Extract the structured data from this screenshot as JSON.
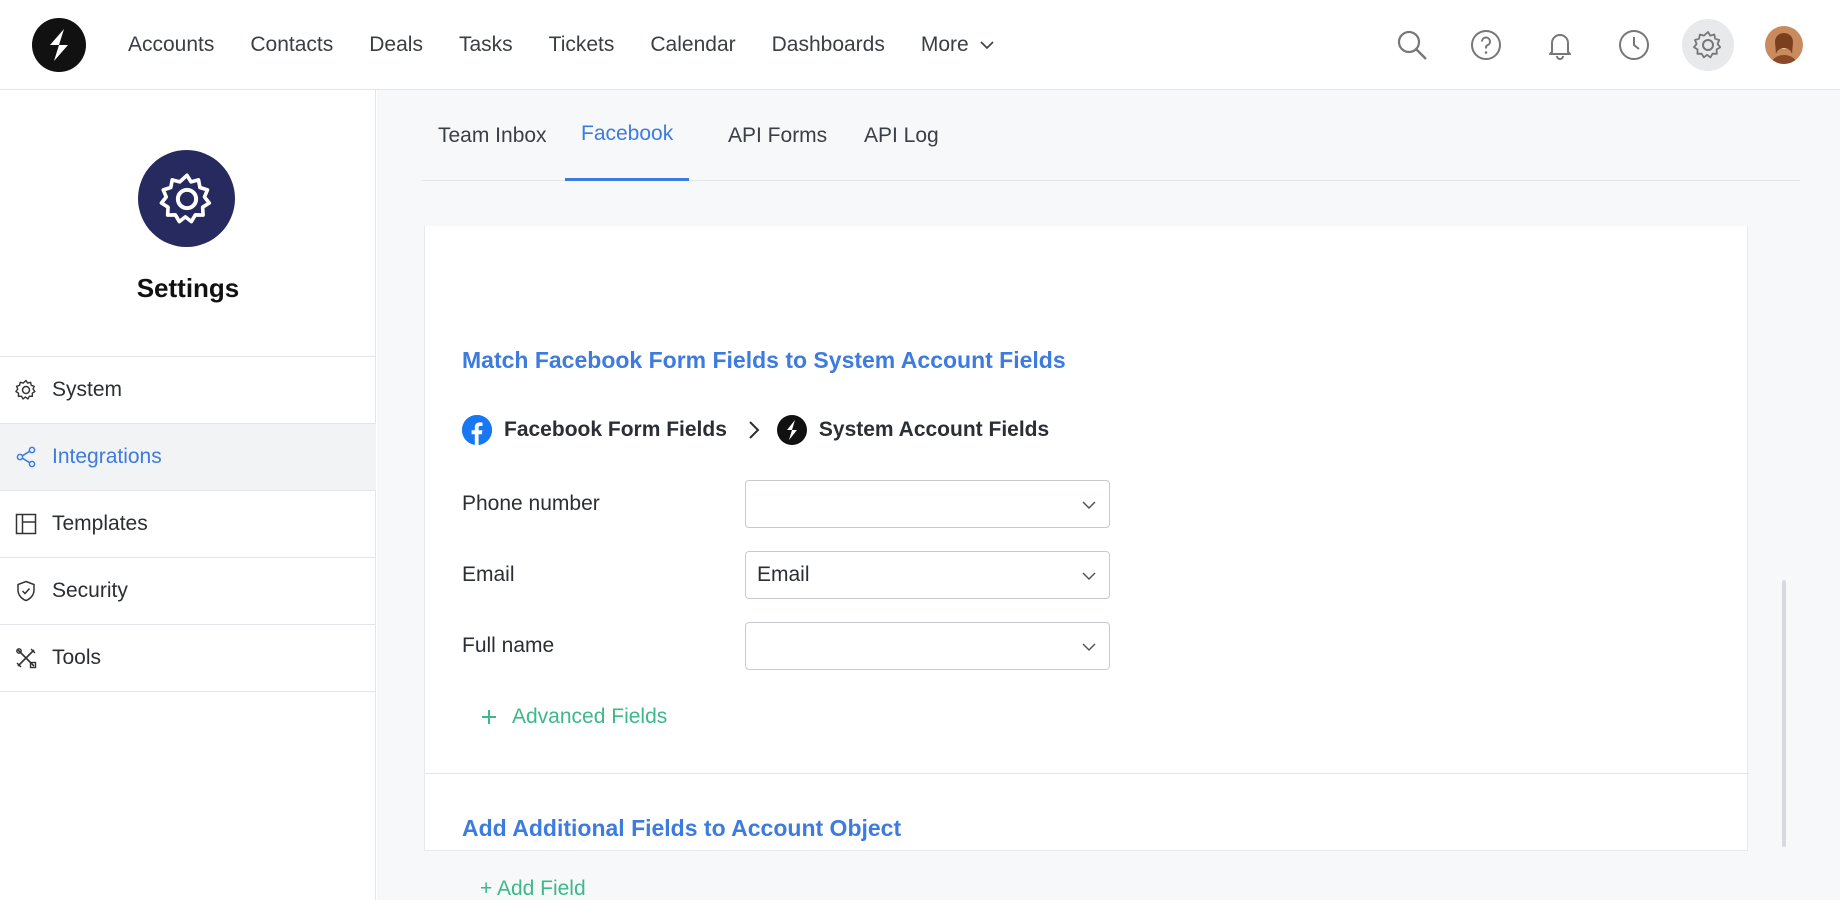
{
  "nav": {
    "items": [
      "Accounts",
      "Contacts",
      "Deals",
      "Tasks",
      "Tickets",
      "Calendar",
      "Dashboards",
      "More"
    ]
  },
  "top_icons": [
    "search-icon",
    "help-icon",
    "bell-icon",
    "clock-icon",
    "gear-icon",
    "avatar"
  ],
  "sidebar": {
    "title": "Settings",
    "items": [
      {
        "label": "System",
        "icon": "gear-icon"
      },
      {
        "label": "Integrations",
        "icon": "share-icon"
      },
      {
        "label": "Templates",
        "icon": "template-icon"
      },
      {
        "label": "Security",
        "icon": "shield-icon"
      },
      {
        "label": "Tools",
        "icon": "tools-icon"
      }
    ]
  },
  "tabs": [
    "Team Inbox",
    "Facebook",
    "API Forms",
    "API Log"
  ],
  "card": {
    "match_title": "Match Facebook Form Fields to System Account Fields",
    "source_label": "Facebook Form Fields",
    "target_label": "System Account Fields",
    "fields": [
      {
        "label": "Phone number",
        "value": ""
      },
      {
        "label": "Email",
        "value": "Email"
      },
      {
        "label": "Full name",
        "value": ""
      }
    ],
    "advanced_label": "Advanced Fields",
    "additional_title": "Add Additional Fields to Account Object",
    "add_field_label": "+ Add Field"
  },
  "colors": {
    "accent": "#3d7be0",
    "green": "#3cb88a",
    "badge": "#262a5e"
  }
}
